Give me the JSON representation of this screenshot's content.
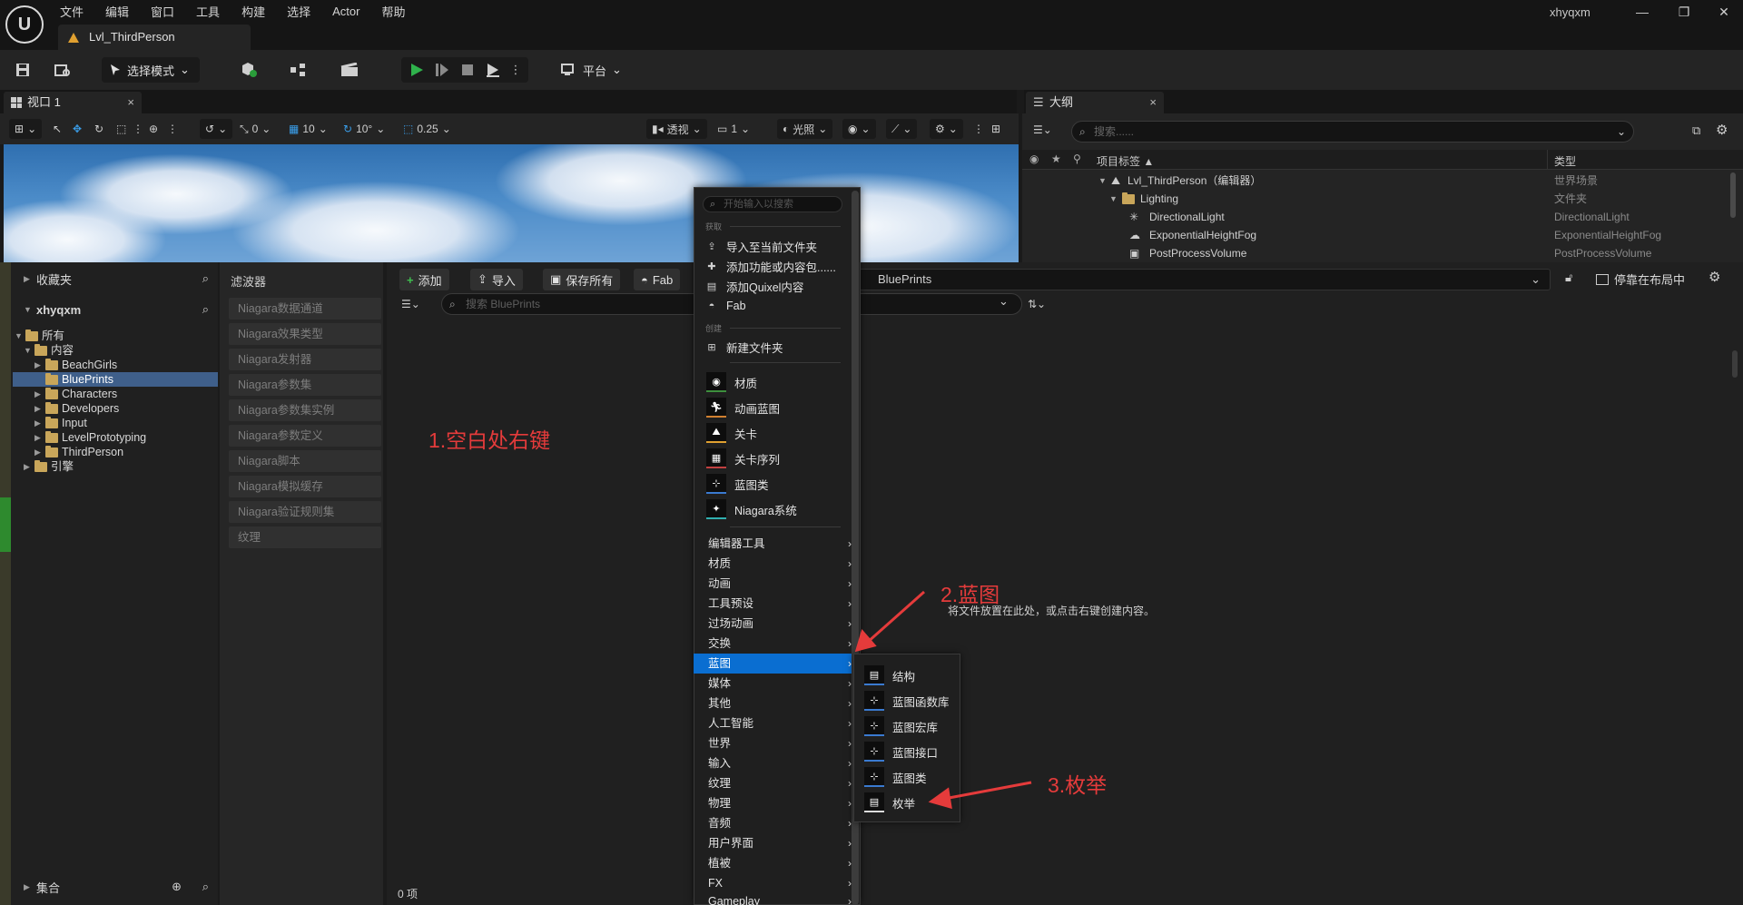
{
  "app": {
    "menus": [
      "文件",
      "编辑",
      "窗口",
      "工具",
      "构建",
      "选择",
      "Actor",
      "帮助"
    ],
    "level_tab": "Lvl_ThirdPerson",
    "user": "xhyqxm"
  },
  "toolbar": {
    "mode_label": "选择模式",
    "platform_label": "平台"
  },
  "viewport": {
    "tab_label": "视口 1",
    "snap_translate": "0",
    "grid_size": "10",
    "rotate_snap": "10°",
    "scale_snap": "0.25",
    "view_mode": "透视",
    "camera_speed": "1",
    "lighting": "光照"
  },
  "outliner": {
    "tab_label": "大纲",
    "search_placeholder": "搜索......",
    "col_label": "项目标签 ▲",
    "col_type": "类型",
    "rows": [
      {
        "label": "Lvl_ThirdPerson（编辑器）",
        "type": "世界场景"
      },
      {
        "label": "Lighting",
        "type": "文件夹"
      },
      {
        "label": "DirectionalLight",
        "type": "DirectionalLight"
      },
      {
        "label": "ExponentialHeightFog",
        "type": "ExponentialHeightFog"
      },
      {
        "label": "PostProcessVolume",
        "type": "PostProcessVolume"
      }
    ]
  },
  "content_browser": {
    "favorites": "收藏夹",
    "project": "xhyqxm",
    "tree": [
      "所有",
      "内容",
      "BeachGirls",
      "BluePrints",
      "Characters",
      "Developers",
      "Input",
      "LevelPrototyping",
      "ThirdPerson",
      "引擎"
    ],
    "collections": "集合",
    "filters_title": "滤波器",
    "filters": [
      "Niagara数据通道",
      "Niagara效果类型",
      "Niagara发射器",
      "Niagara参数集",
      "Niagara参数集实例",
      "Niagara参数定义",
      "Niagara脚本",
      "Niagara模拟缓存",
      "Niagara验证规则集",
      "纹理"
    ],
    "add_btn": "添加",
    "import_btn": "导入",
    "save_all_btn": "保存所有",
    "fab_btn": "Fab",
    "search_placeholder": "搜索 BluePrints",
    "path": "BluePrints",
    "dock_label": "停靠在布局中",
    "empty_hint": "将文件放置在此处，或点击右键创建内容。",
    "item_count": "0 项"
  },
  "context_menu": {
    "search_placeholder": "开始输入以搜索",
    "section_get": "获取",
    "get_items": [
      "导入至当前文件夹",
      "添加功能或内容包......",
      "添加Quixel内容",
      "Fab"
    ],
    "section_create": "创建",
    "new_folder": "新建文件夹",
    "assets": [
      "材质",
      "动画蓝图",
      "关卡",
      "关卡序列",
      "蓝图类",
      "Niagara系统"
    ],
    "categories": [
      "编辑器工具",
      "材质",
      "动画",
      "工具预设",
      "过场动画",
      "交换",
      "蓝图",
      "媒体",
      "其他",
      "人工智能",
      "世界",
      "输入",
      "纹理",
      "物理",
      "音频",
      "用户界面",
      "植被",
      "FX",
      "Gameplay"
    ],
    "selected_category": "蓝图"
  },
  "submenu": {
    "items": [
      "结构",
      "蓝图函数库",
      "蓝图宏库",
      "蓝图接口",
      "蓝图类",
      "枚举"
    ]
  },
  "annotations": {
    "step1": "1.空白处右键",
    "step2": "2.蓝图",
    "step3": "3.枚举",
    "color": "#e53b3b"
  }
}
